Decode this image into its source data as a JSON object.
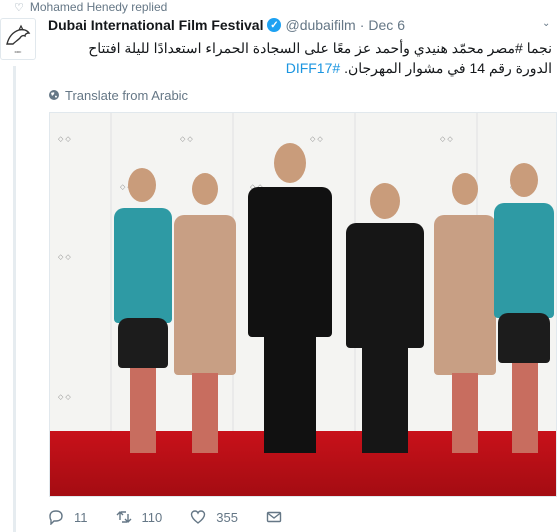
{
  "reply_context": {
    "text": "Mohamed Henedy replied",
    "icon": "heart-icon"
  },
  "tweet": {
    "author_name": "Dubai International Film Festival",
    "author_handle": "@dubaifilm",
    "separator": "·",
    "time": "Dec 6",
    "text_main": "نجما #مصر محمّد هنيدي وأحمد عز معًا على السجادة الحمراء استعدادًا لليلة افتتاح الدورة رقم 14 في مشوار المهرجان.",
    "hashtag": "#DIFF17",
    "translate_label": "Translate from Arabic"
  },
  "actions": {
    "reply_count": "11",
    "retweet_count": "110",
    "like_count": "355"
  },
  "colors": {
    "link": "#1b95e0",
    "verified": "#1da1f2",
    "muted": "#657786",
    "carpet": "#c8111a"
  }
}
